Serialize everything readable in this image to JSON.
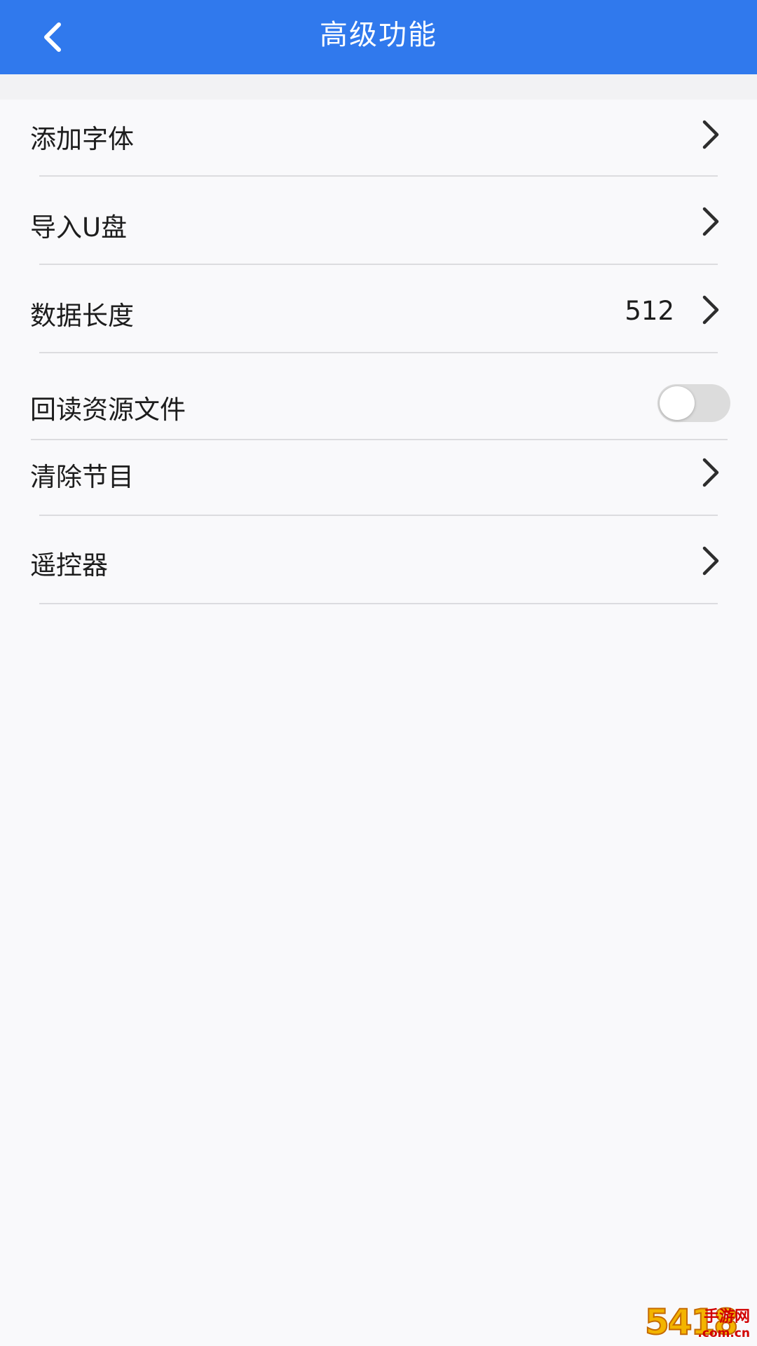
{
  "header": {
    "title": "高级功能",
    "back_icon": "chevron-left-icon",
    "background_color": "#3079ed"
  },
  "settings": {
    "items": [
      {
        "label": "添加字体",
        "type": "link",
        "icon": "chevron-right-icon"
      },
      {
        "label": "导入U盘",
        "type": "link",
        "icon": "chevron-right-icon"
      },
      {
        "label": "数据长度",
        "type": "link",
        "value": "512",
        "icon": "chevron-right-icon"
      },
      {
        "label": "回读资源文件",
        "type": "toggle",
        "enabled": false
      },
      {
        "label": "清除节目",
        "type": "link",
        "icon": "chevron-right-icon"
      },
      {
        "label": "遥控器",
        "type": "link",
        "icon": "chevron-right-icon"
      }
    ]
  },
  "watermark": {
    "logo_text": "5418",
    "site_name": "手游网",
    "domain": ".com.cn"
  }
}
